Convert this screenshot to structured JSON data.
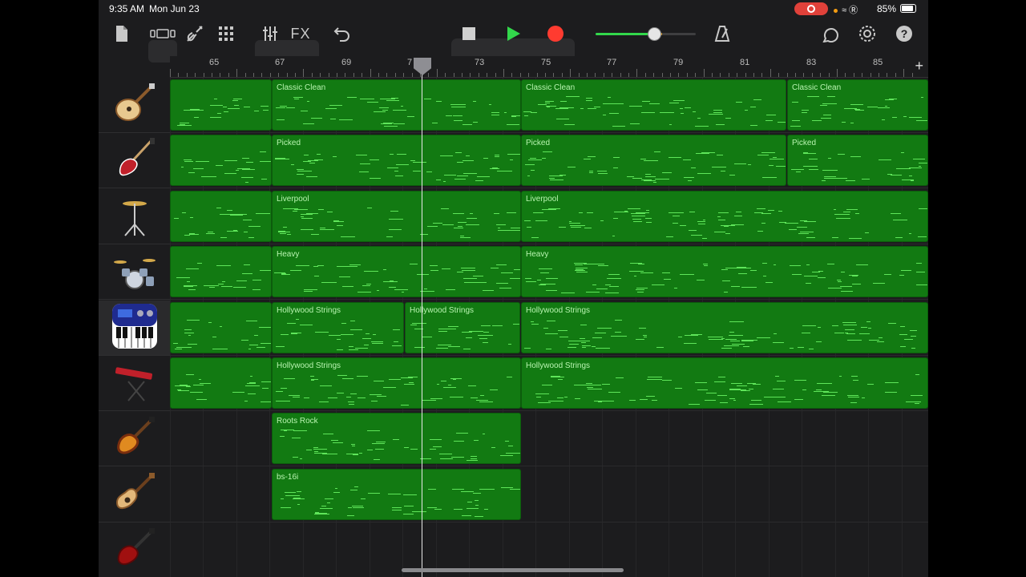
{
  "status": {
    "time": "9:35 AM",
    "date": "Mon Jun 23",
    "battery": "85%"
  },
  "toolbar": {
    "fx_label": "FX",
    "icons": [
      "my-songs-icon",
      "view-toggle-icon",
      "instrument-icon",
      "grid-view-icon",
      "mixer-icon",
      "fx-button",
      "undo-icon",
      "stop-icon",
      "play-icon",
      "record-icon",
      "metronome-icon",
      "loop-browser-icon",
      "settings-icon",
      "help-icon"
    ],
    "volume_level": 0.58
  },
  "ruler": {
    "labels": [
      "65",
      "67",
      "69",
      "7",
      "73",
      "75",
      "77",
      "79",
      "81",
      "83",
      "85"
    ]
  },
  "tracks": [
    {
      "instrument": "electric-guitar-hollow",
      "regions": [
        {
          "name": ""
        },
        {
          "name": "Classic Clean"
        },
        {
          "name": "Classic Clean"
        },
        {
          "name": "Classic Clean"
        }
      ]
    },
    {
      "instrument": "bass-guitar",
      "regions": [
        {
          "name": ""
        },
        {
          "name": "Picked"
        },
        {
          "name": "Picked"
        },
        {
          "name": "Picked"
        }
      ]
    },
    {
      "instrument": "drums-cymbal",
      "regions": [
        {
          "name": ""
        },
        {
          "name": "Liverpool"
        },
        {
          "name": "Liverpool"
        }
      ]
    },
    {
      "instrument": "drum-kit",
      "regions": [
        {
          "name": ""
        },
        {
          "name": "Heavy"
        },
        {
          "name": "Heavy"
        }
      ]
    },
    {
      "instrument": "keyboard-synth",
      "regions": [
        {
          "name": ""
        },
        {
          "name": "Hollywood Strings"
        },
        {
          "name": "Hollywood Strings"
        },
        {
          "name": "Hollywood Strings"
        }
      ]
    },
    {
      "instrument": "stage-keyboard",
      "regions": [
        {
          "name": ""
        },
        {
          "name": "Hollywood Strings"
        },
        {
          "name": "Hollywood Strings"
        }
      ]
    },
    {
      "instrument": "sunburst-guitar",
      "regions": [
        {
          "name": "Roots Rock"
        }
      ]
    },
    {
      "instrument": "acoustic-guitar",
      "regions": [
        {
          "name": "bs-16i"
        }
      ]
    },
    {
      "instrument": "red-electric-guitar",
      "regions": []
    }
  ]
}
